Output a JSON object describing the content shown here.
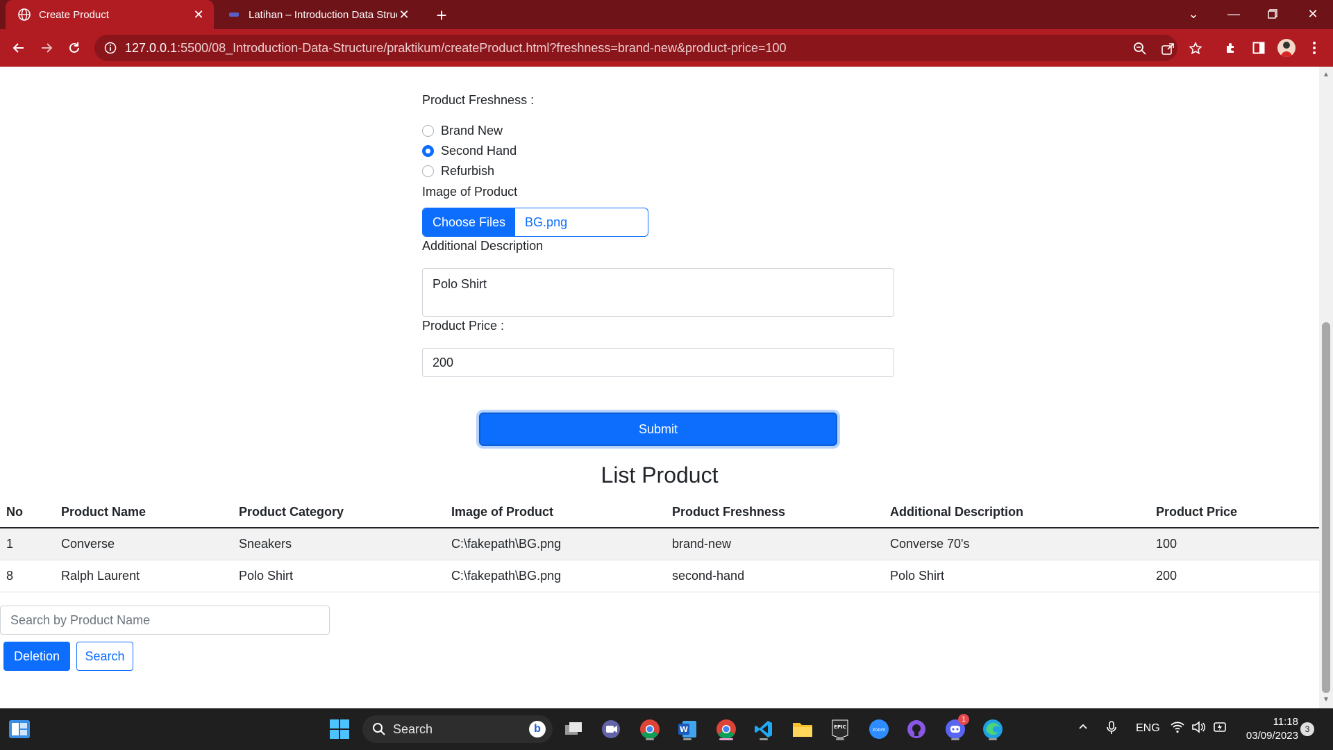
{
  "browser": {
    "tabs": [
      {
        "title": "Create Product",
        "active": true
      },
      {
        "title": "Latihan – Introduction Data Struc",
        "active": false
      }
    ],
    "url_host": "127.0.0.1",
    "url_path": ":5500/08_Introduction-Data-Structure/praktikum/createProduct.html?freshness=brand-new&product-price=100"
  },
  "form": {
    "freshness_label": "Product Freshness :",
    "freshness_options": [
      {
        "label": "Brand New",
        "checked": false
      },
      {
        "label": "Second Hand",
        "checked": true
      },
      {
        "label": "Refurbish",
        "checked": false
      }
    ],
    "image_label": "Image of Product",
    "choose_files_label": "Choose Files",
    "file_name": "BG.png",
    "description_label": "Additional Description",
    "description_value": "Polo Shirt",
    "price_label": "Product Price :",
    "price_value": "200",
    "submit_label": "Submit"
  },
  "list": {
    "title": "List Product",
    "columns": [
      "No",
      "Product Name",
      "Product Category",
      "Image of Product",
      "Product Freshness",
      "Additional Description",
      "Product Price"
    ],
    "rows": [
      [
        "1",
        "Converse",
        "Sneakers",
        "C:\\fakepath\\BG.png",
        "brand-new",
        "Converse 70's",
        "100"
      ],
      [
        "8",
        "Ralph Laurent",
        "Polo Shirt",
        "C:\\fakepath\\BG.png",
        "second-hand",
        "Polo Shirt",
        "200"
      ]
    ]
  },
  "controls": {
    "search_placeholder": "Search by Product Name",
    "deletion_label": "Deletion",
    "search_label": "Search"
  },
  "taskbar": {
    "search_label": "Search",
    "language": "ENG",
    "time": "11:18",
    "date": "03/09/2023",
    "notification_count": "3",
    "discord_badge": "1"
  },
  "colors": {
    "chrome_dark": "#6e1317",
    "chrome": "#b01c22",
    "primary": "#0d6efd",
    "taskbar": "#1f1f1f"
  }
}
